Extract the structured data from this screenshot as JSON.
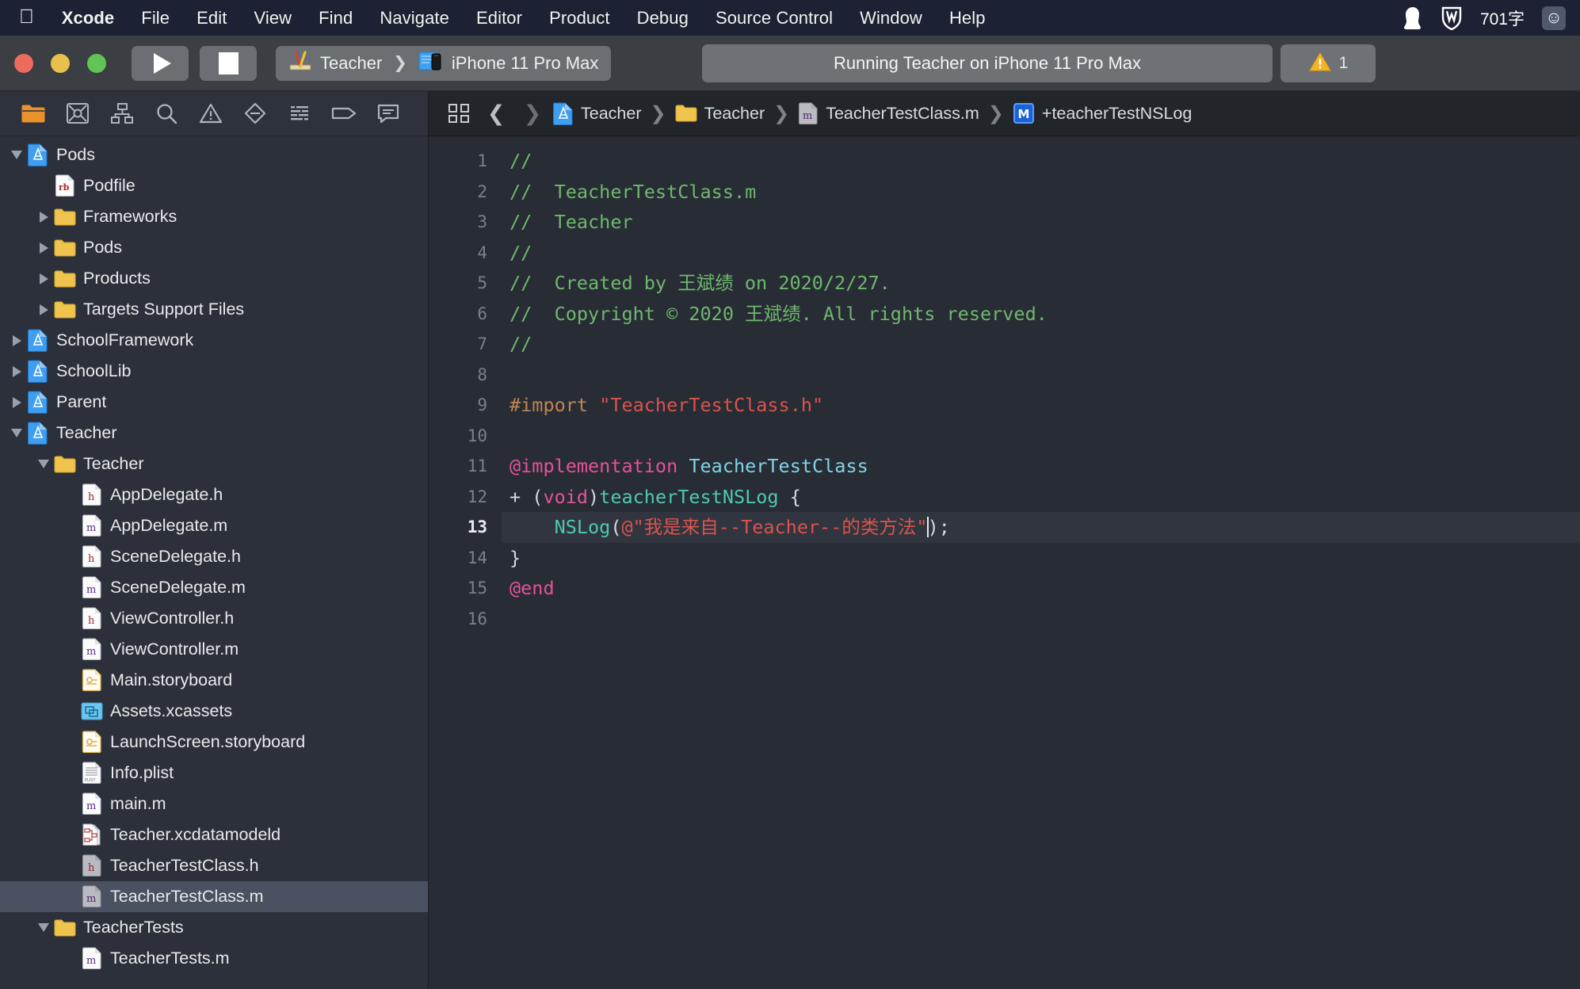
{
  "menubar": {
    "apple_icon": "apple-logo",
    "items": [
      {
        "label": "Xcode",
        "bold": true
      },
      {
        "label": "File",
        "bold": false
      },
      {
        "label": "Edit",
        "bold": false
      },
      {
        "label": "View",
        "bold": false
      },
      {
        "label": "Find",
        "bold": false
      },
      {
        "label": "Navigate",
        "bold": false
      },
      {
        "label": "Editor",
        "bold": false
      },
      {
        "label": "Product",
        "bold": false
      },
      {
        "label": "Debug",
        "bold": false
      },
      {
        "label": "Source Control",
        "bold": false
      },
      {
        "label": "Window",
        "bold": false
      },
      {
        "label": "Help",
        "bold": false
      }
    ],
    "status_items": {
      "qq_icon": "penguin-icon",
      "w_icon": "w-logo-icon",
      "word_count": "701字",
      "smiley_icon": "smiley-face-icon"
    }
  },
  "toolbar": {
    "run_button": "run-icon",
    "stop_button": "stop-icon",
    "scheme": {
      "target": "Teacher",
      "separator": "❯",
      "destination": "iPhone 11 Pro Max"
    },
    "activity_status": "Running Teacher on iPhone 11 Pro Max",
    "warning_count": "1"
  },
  "navigator": {
    "tabs": [
      {
        "name": "project-navigator",
        "active": true
      },
      {
        "name": "source-control-navigator",
        "active": false
      },
      {
        "name": "symbol-navigator",
        "active": false
      },
      {
        "name": "find-navigator",
        "active": false
      },
      {
        "name": "issue-navigator",
        "active": false
      },
      {
        "name": "test-navigator",
        "active": false
      },
      {
        "name": "debug-navigator",
        "active": false
      },
      {
        "name": "breakpoint-navigator",
        "active": false
      },
      {
        "name": "report-navigator",
        "active": false
      }
    ],
    "tree": [
      {
        "label": "Pods",
        "indent": 0,
        "icon": "project",
        "twisty": "down",
        "selected": false
      },
      {
        "label": "Podfile",
        "indent": 1,
        "icon": "ruby",
        "twisty": "none",
        "selected": false
      },
      {
        "label": "Frameworks",
        "indent": 1,
        "icon": "folder",
        "twisty": "right",
        "selected": false
      },
      {
        "label": "Pods",
        "indent": 1,
        "icon": "folder",
        "twisty": "right",
        "selected": false
      },
      {
        "label": "Products",
        "indent": 1,
        "icon": "folder",
        "twisty": "right",
        "selected": false
      },
      {
        "label": "Targets Support Files",
        "indent": 1,
        "icon": "folder",
        "twisty": "right",
        "selected": false
      },
      {
        "label": "SchoolFramework",
        "indent": 0,
        "icon": "project",
        "twisty": "right",
        "selected": false
      },
      {
        "label": "SchoolLib",
        "indent": 0,
        "icon": "project",
        "twisty": "right",
        "selected": false
      },
      {
        "label": "Parent",
        "indent": 0,
        "icon": "project",
        "twisty": "right",
        "selected": false
      },
      {
        "label": "Teacher",
        "indent": 0,
        "icon": "project",
        "twisty": "down",
        "selected": false
      },
      {
        "label": "Teacher",
        "indent": 1,
        "icon": "folder",
        "twisty": "down",
        "selected": false
      },
      {
        "label": "AppDelegate.h",
        "indent": 2,
        "icon": "header",
        "twisty": "none",
        "selected": false
      },
      {
        "label": "AppDelegate.m",
        "indent": 2,
        "icon": "impl",
        "twisty": "none",
        "selected": false
      },
      {
        "label": "SceneDelegate.h",
        "indent": 2,
        "icon": "header",
        "twisty": "none",
        "selected": false
      },
      {
        "label": "SceneDelegate.m",
        "indent": 2,
        "icon": "impl",
        "twisty": "none",
        "selected": false
      },
      {
        "label": "ViewController.h",
        "indent": 2,
        "icon": "header",
        "twisty": "none",
        "selected": false
      },
      {
        "label": "ViewController.m",
        "indent": 2,
        "icon": "impl",
        "twisty": "none",
        "selected": false
      },
      {
        "label": "Main.storyboard",
        "indent": 2,
        "icon": "storyboard",
        "twisty": "none",
        "selected": false
      },
      {
        "label": "Assets.xcassets",
        "indent": 2,
        "icon": "assets",
        "twisty": "none",
        "selected": false
      },
      {
        "label": "LaunchScreen.storyboard",
        "indent": 2,
        "icon": "storyboard",
        "twisty": "none",
        "selected": false
      },
      {
        "label": "Info.plist",
        "indent": 2,
        "icon": "plist",
        "twisty": "none",
        "selected": false
      },
      {
        "label": "main.m",
        "indent": 2,
        "icon": "impl",
        "twisty": "none",
        "selected": false
      },
      {
        "label": "Teacher.xcdatamodeld",
        "indent": 2,
        "icon": "datamodel",
        "twisty": "none",
        "selected": false
      },
      {
        "label": "TeacherTestClass.h",
        "indent": 2,
        "icon": "header-dim",
        "twisty": "none",
        "selected": false
      },
      {
        "label": "TeacherTestClass.m",
        "indent": 2,
        "icon": "impl-dim",
        "twisty": "none",
        "selected": true
      },
      {
        "label": "TeacherTests",
        "indent": 1,
        "icon": "folder",
        "twisty": "down",
        "selected": false
      },
      {
        "label": "TeacherTests.m",
        "indent": 2,
        "icon": "impl",
        "twisty": "none",
        "selected": false
      }
    ]
  },
  "editor": {
    "breadcrumb": [
      {
        "label": "Teacher",
        "icon": "project"
      },
      {
        "label": "Teacher",
        "icon": "folder"
      },
      {
        "label": "TeacherTestClass.m",
        "icon": "impl-dim"
      },
      {
        "label": "+teacherTestNSLog",
        "icon": "method-badge-m"
      }
    ],
    "back_arrow": "❮",
    "forward_arrow": "❯",
    "separator": "❯",
    "code": {
      "current_line": 13,
      "total_gutter_lines": 16,
      "lines": [
        {
          "n": 1,
          "tokens": [
            {
              "t": "//",
              "c": "cm"
            }
          ]
        },
        {
          "n": 2,
          "tokens": [
            {
              "t": "//  TeacherTestClass.m",
              "c": "cm"
            }
          ]
        },
        {
          "n": 3,
          "tokens": [
            {
              "t": "//  Teacher",
              "c": "cm"
            }
          ]
        },
        {
          "n": 4,
          "tokens": [
            {
              "t": "//",
              "c": "cm"
            }
          ]
        },
        {
          "n": 5,
          "tokens": [
            {
              "t": "//  Created by 王斌绩 on 2020/2/27.",
              "c": "cm"
            }
          ]
        },
        {
          "n": 6,
          "tokens": [
            {
              "t": "//  Copyright © 2020 王斌绩. All rights reserved.",
              "c": "cm"
            }
          ]
        },
        {
          "n": 7,
          "tokens": [
            {
              "t": "//",
              "c": "cm"
            }
          ]
        },
        {
          "n": 8,
          "tokens": []
        },
        {
          "n": 9,
          "tokens": [
            {
              "t": "#import ",
              "c": "pre"
            },
            {
              "t": "\"TeacherTestClass.h\"",
              "c": "str"
            }
          ]
        },
        {
          "n": 10,
          "tokens": []
        },
        {
          "n": 11,
          "tokens": [
            {
              "t": "@implementation ",
              "c": "kw"
            },
            {
              "t": "TeacherTestClass",
              "c": "typ"
            }
          ]
        },
        {
          "n": 12,
          "tokens": [
            {
              "t": "+ (",
              "c": "pln"
            },
            {
              "t": "void",
              "c": "kw"
            },
            {
              "t": ")",
              "c": "pln"
            },
            {
              "t": "teacherTestNSLog",
              "c": "fn"
            },
            {
              "t": " {",
              "c": "pln"
            }
          ]
        },
        {
          "n": 13,
          "tokens": [
            {
              "t": "    ",
              "c": "pln"
            },
            {
              "t": "NSLog",
              "c": "fn"
            },
            {
              "t": "(",
              "c": "pln"
            },
            {
              "t": "@\"我是来自--Teacher--的类方法\"",
              "c": "str"
            },
            {
              "t": "CARET",
              "c": "caret"
            },
            {
              "t": ");",
              "c": "pln"
            }
          ]
        },
        {
          "n": 14,
          "tokens": [
            {
              "t": "}",
              "c": "pln"
            }
          ]
        },
        {
          "n": 15,
          "tokens": [
            {
              "t": "@end",
              "c": "kw"
            }
          ]
        },
        {
          "n": 16,
          "tokens": []
        }
      ]
    }
  },
  "colors": {
    "menubar_bg": "#1c2233",
    "toolbar_bg": "#3b3f44",
    "navigator_bg": "#2b303a",
    "editor_bg": "#282c34",
    "selection_bg": "#4a5160",
    "current_line_bg": "#31353f",
    "comment": "#6eb86e",
    "string": "#d9544d",
    "keyword": "#e6519a",
    "type": "#7fd4e8",
    "function": "#4ec9b0",
    "preprocessor": "#bf8555",
    "warning": "#f0b429",
    "accent_orange": "#e8912d"
  }
}
